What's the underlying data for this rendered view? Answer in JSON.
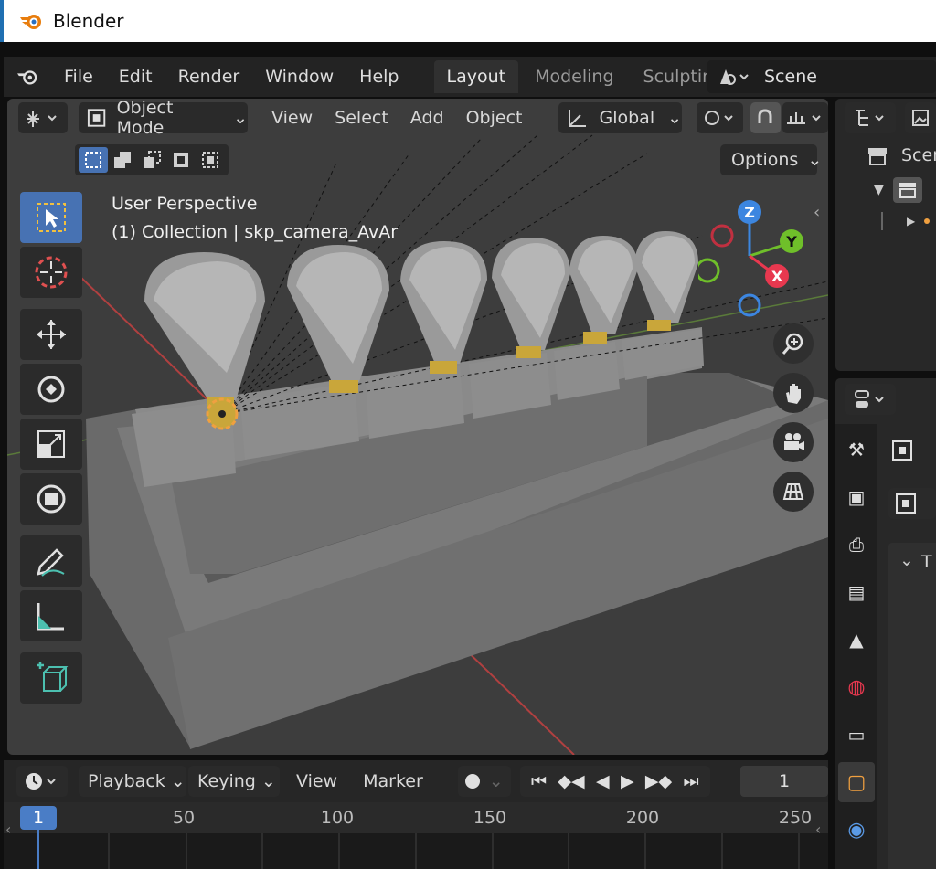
{
  "window": {
    "title": "Blender"
  },
  "menu": {
    "file": "File",
    "edit": "Edit",
    "render": "Render",
    "window": "Window",
    "help": "Help"
  },
  "workspaces": {
    "layout": "Layout",
    "modeling": "Modeling",
    "sculpting": "Sculpting"
  },
  "scene": {
    "name": "Scene"
  },
  "viewport": {
    "mode": "Object Mode",
    "menus": {
      "view": "View",
      "select": "Select",
      "add": "Add",
      "object": "Object"
    },
    "orientation": "Global",
    "options": "Options",
    "perspective_label": "User Perspective",
    "collection_label": "(1) Collection | skp_camera_AvAr"
  },
  "gizmo": {
    "z": "Z",
    "y": "Y",
    "x": "X"
  },
  "outliner": {
    "scene_label": "Scer"
  },
  "timeline": {
    "menus": {
      "playback": "Playback",
      "keying": "Keying",
      "view": "View",
      "marker": "Marker"
    },
    "current_frame": "1",
    "frame_field": "1",
    "ticks": [
      "50",
      "100",
      "150",
      "200",
      "250"
    ]
  },
  "properties": {
    "panel_label_clip": "T"
  },
  "colors": {
    "accent": "#4772b3",
    "x_axis": "#e8384f",
    "y_axis": "#6fbf2a",
    "z_axis": "#3c86e0",
    "bg": "#3d3d3d"
  }
}
